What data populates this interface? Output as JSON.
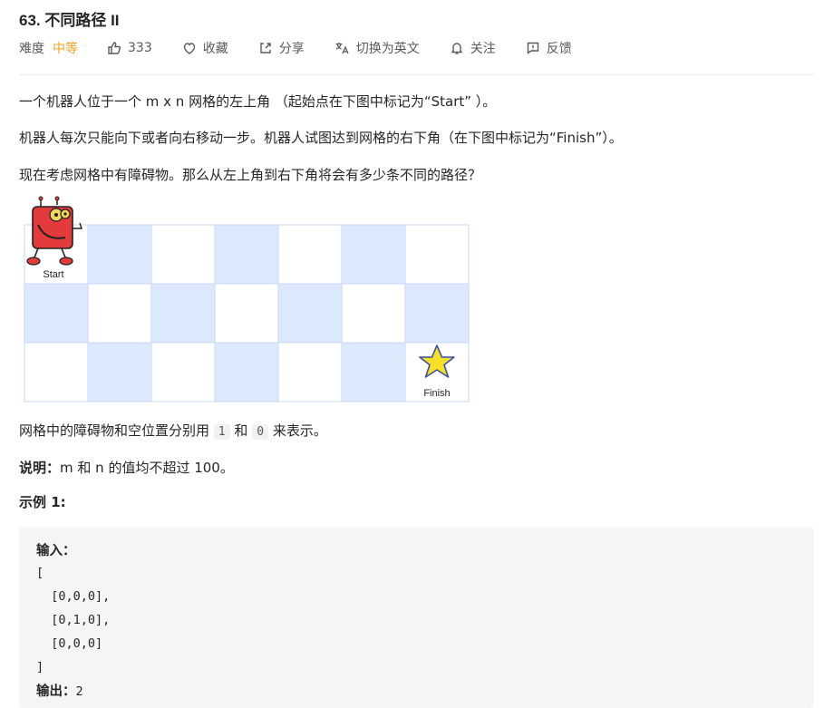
{
  "problem": {
    "title": "63. 不同路径 II",
    "difficulty_label": "难度",
    "difficulty_value": "中等",
    "likes": "333",
    "favorite_label": "收藏",
    "share_label": "分享",
    "translate_label": "切换为英文",
    "follow_label": "关注",
    "feedback_label": "反馈"
  },
  "description": {
    "p1": "一个机器人位于一个 m x n 网格的左上角 （起始点在下图中标记为“Start” ）。",
    "p2": "机器人每次只能向下或者向右移动一步。机器人试图达到网格的右下角（在下图中标记为“Finish”）。",
    "p3": "现在考虑网格中有障碍物。那么从左上角到右下角将会有多少条不同的路径？",
    "p4_prefix": "网格中的障碍物和空位置分别用",
    "p4_code1": "1",
    "p4_mid": "和",
    "p4_code2": "0",
    "p4_suffix": "来表示。",
    "note_label": "说明：",
    "note_text": "m 和 n 的值均不超过 100。",
    "example_title": "示例 1:"
  },
  "figure": {
    "start_label": "Start",
    "finish_label": "Finish",
    "rows": 3,
    "cols": 7,
    "colors": {
      "blue": "#dce8fb",
      "white": "#ffffff",
      "border": "#c9daf5",
      "star": "#f7e02a",
      "robot": "#e33b3b"
    }
  },
  "example": {
    "input_label": "输入：",
    "lines": [
      "[",
      "  [0,0,0],",
      "  [0,1,0],",
      "  [0,0,0]",
      "]"
    ],
    "output_label": "输出：",
    "output_value": "2"
  }
}
